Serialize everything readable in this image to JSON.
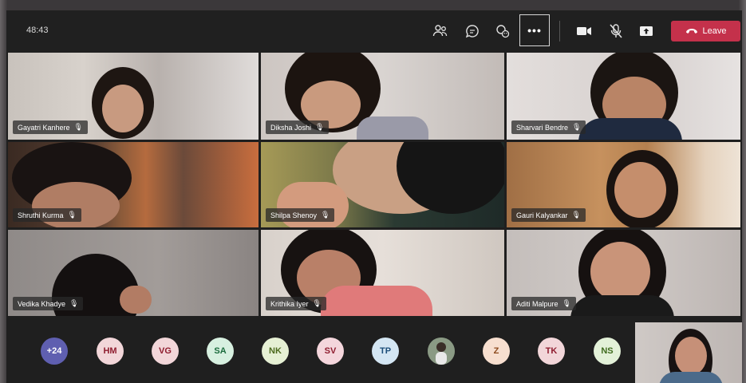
{
  "meeting": {
    "timer": "48:43",
    "leave_label": "Leave",
    "more_label": "•••"
  },
  "toolbar_icons": [
    "participants-icon",
    "chat-icon",
    "reactions-icon",
    "more-options-icon",
    "camera-icon",
    "mic-muted-icon",
    "share-screen-icon",
    "phone-hangup-icon"
  ],
  "participants": [
    {
      "name": "Gayatri Kanhere",
      "bg": "#bdb7b3"
    },
    {
      "name": "Diksha Joshi",
      "bg": "#c9c2bf"
    },
    {
      "name": "Sharvari Bendre",
      "bg": "#d9d4d2"
    },
    {
      "name": "Shruthi Kurma",
      "bg": "#7b5a44"
    },
    {
      "name": "Shilpa Shenoy",
      "bg": "#8a7e47"
    },
    {
      "name": "Gauri Kalyankar",
      "bg": "#c08a5b"
    },
    {
      "name": "Vedika Khadye",
      "bg": "#908a88"
    },
    {
      "name": "Krithika Iyer",
      "bg": "#ded7d1"
    },
    {
      "name": "Aditi Malpure",
      "bg": "#c7c1be"
    }
  ],
  "roster": [
    {
      "initials": "+24",
      "bg": "#5f5fb0",
      "fg": "#ffffff"
    },
    {
      "initials": "HM",
      "bg": "#f2d6d9",
      "fg": "#8f1d2f"
    },
    {
      "initials": "VG",
      "bg": "#f2d6d9",
      "fg": "#8f1d2f"
    },
    {
      "initials": "SA",
      "bg": "#d7f0e0",
      "fg": "#1b6b3d"
    },
    {
      "initials": "NK",
      "bg": "#e6f0d4",
      "fg": "#4c6a1d"
    },
    {
      "initials": "SV",
      "bg": "#f4d6dc",
      "fg": "#8f1d2f"
    },
    {
      "initials": "TP",
      "bg": "#d4e6f3",
      "fg": "#1d4f7a"
    },
    {
      "initials": "",
      "bg": "#6d7b6a",
      "fg": "#ffffff"
    },
    {
      "initials": "Z",
      "bg": "#f7dfcf",
      "fg": "#8c4a1c"
    },
    {
      "initials": "TK",
      "bg": "#f2d6d9",
      "fg": "#8f1d2f"
    },
    {
      "initials": "NS",
      "bg": "#e3f1d8",
      "fg": "#3f6b1d"
    }
  ]
}
